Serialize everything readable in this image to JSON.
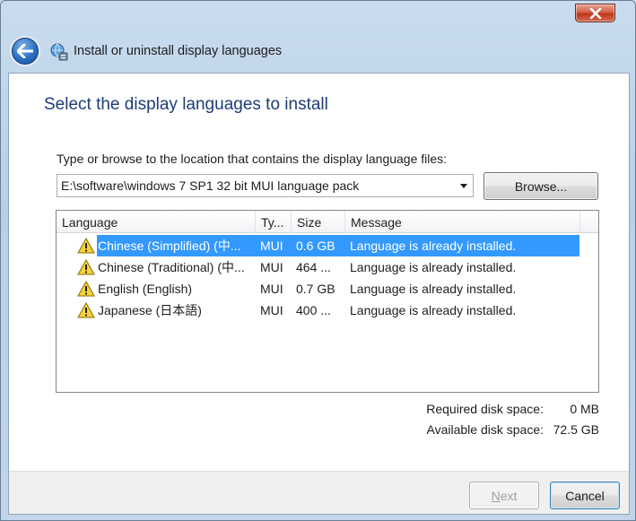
{
  "window": {
    "title": "Install or uninstall display languages",
    "close_glyph": "×"
  },
  "main": {
    "heading": "Select the display languages to install",
    "prompt": "Type or browse to the location that contains the display language files:",
    "path_value": "E:\\software\\windows 7 SP1 32 bit MUI language pack",
    "browse_label": "Browse..."
  },
  "list": {
    "columns": [
      "Language",
      "Ty...",
      "Size",
      "Message"
    ],
    "rows": [
      {
        "language": "Chinese (Simplified) (中...",
        "type": "MUI",
        "size": "0.6 GB",
        "message": "Language is already installed.",
        "selected": true
      },
      {
        "language": "Chinese (Traditional) (中...",
        "type": "MUI",
        "size": "464 ...",
        "message": "Language is already installed.",
        "selected": false
      },
      {
        "language": "English (English)",
        "type": "MUI",
        "size": "0.7 GB",
        "message": "Language is already installed.",
        "selected": false
      },
      {
        "language": "Japanese (日本語)",
        "type": "MUI",
        "size": "400 ...",
        "message": "Language is already installed.",
        "selected": false
      }
    ],
    "row_icon": "warning-icon"
  },
  "disk": {
    "required_label": "Required disk space:",
    "required_value": "0 MB",
    "available_label": "Available disk space:",
    "available_value": "72.5 GB"
  },
  "footer": {
    "next_label": "Next",
    "next_mnemonic": "N",
    "next_rest": "ext",
    "cancel_label": "Cancel"
  },
  "colors": {
    "selection": "#3399ff",
    "heading": "#1e3d78",
    "close_button": "#c8452a"
  }
}
